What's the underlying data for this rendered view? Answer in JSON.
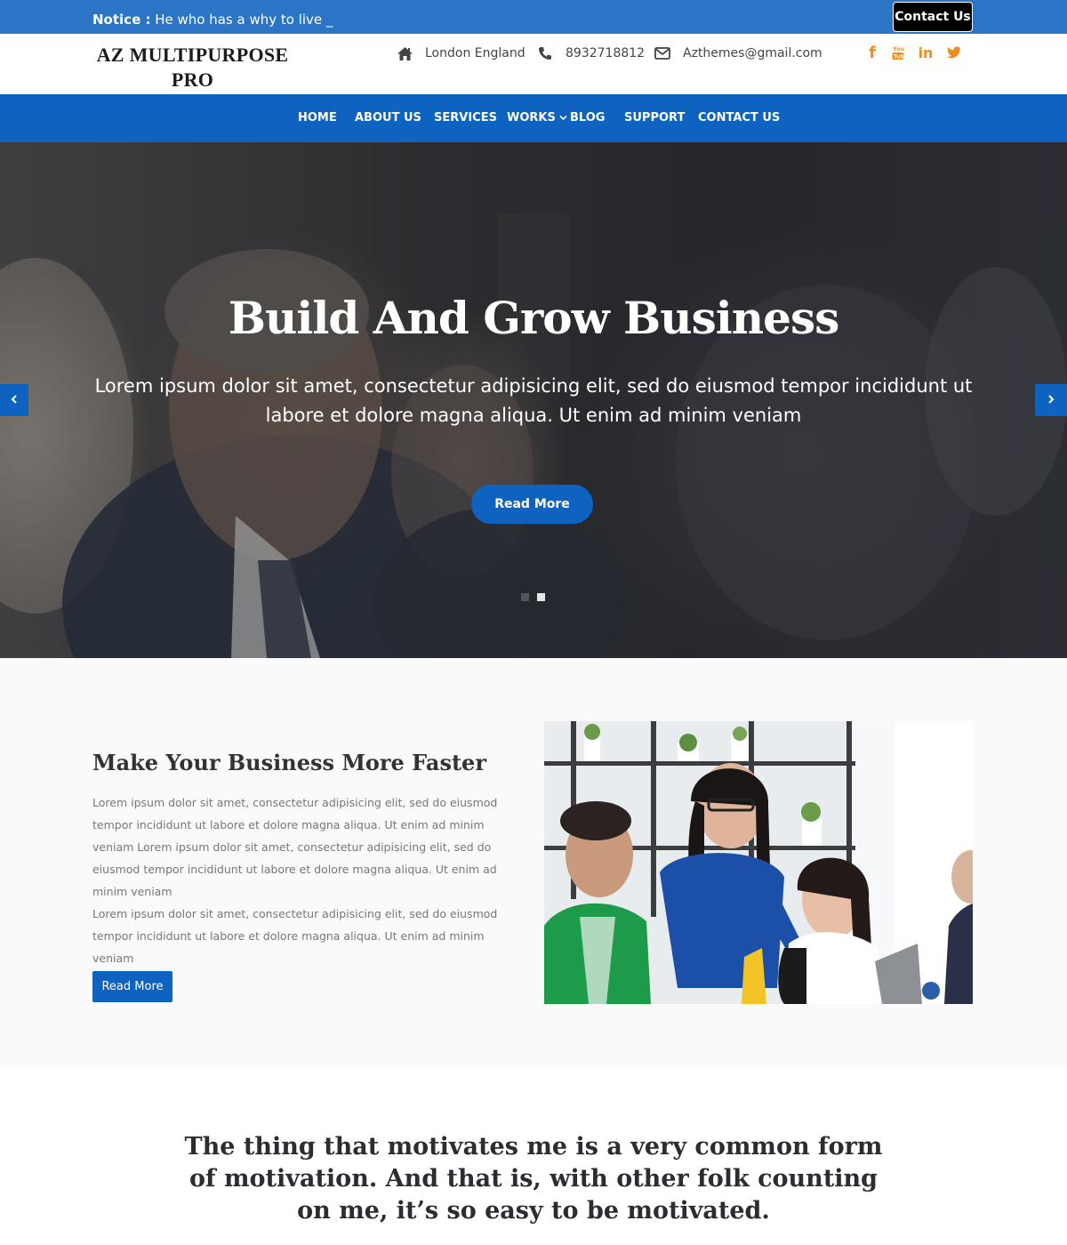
{
  "notice": {
    "label": "Notice :",
    "text": " He who has a why to live _",
    "contact_button": "Contact Us"
  },
  "header": {
    "logo_line1": "AZ MULTIPURPOSE",
    "logo_line2": "PRO",
    "address": "London England",
    "phone": "8932718812",
    "email": "Azthemes@gmail.com",
    "social_icons": [
      "facebook-icon",
      "youtube-icon",
      "linkedin-icon",
      "twitter-icon"
    ],
    "social_color": "#f28b1e"
  },
  "nav": {
    "items": [
      "HOME",
      "ABOUT US",
      "SERVICES",
      "WORKS",
      "BLOG",
      "SUPPORT",
      "CONTACT US"
    ],
    "background": "#0f63c0"
  },
  "hero": {
    "title": "Build And Grow Business",
    "subtitle": "Lorem ipsum dolor sit amet, consectetur adipisicing elit, sed do eiusmod tempor incididunt ut labore et dolore magna aliqua. Ut enim ad minim veniam",
    "button": "Read More",
    "prev_icon": "chevron-left-icon",
    "next_icon": "chevron-right-icon",
    "slide_count": 2,
    "active_slide": 2
  },
  "about": {
    "title": "Make Your Business More Faster",
    "paragraph1": "Lorem ipsum dolor sit amet, consectetur adipisicing elit, sed do eiusmod tempor incididunt ut labore et dolore magna aliqua. Ut enim ad minim veniam Lorem ipsum dolor sit amet, consectetur adipisicing elit, sed do eiusmod tempor incididunt ut labore et dolore magna aliqua. Ut enim ad minim veniam",
    "paragraph2": "Lorem ipsum dolor sit amet, consectetur adipisicing elit, sed do eiusmod tempor incididunt ut labore et dolore magna aliqua. Ut enim ad minim veniam",
    "button": "Read More"
  },
  "quote": {
    "text": "The thing that motivates me is a very common form of motivation. And that is, with other folk counting on me, it’s so easy to be motivated."
  },
  "colors": {
    "notice_bar": "#2b74c6",
    "primary": "#0f63c0",
    "accent": "#f28b1e"
  }
}
